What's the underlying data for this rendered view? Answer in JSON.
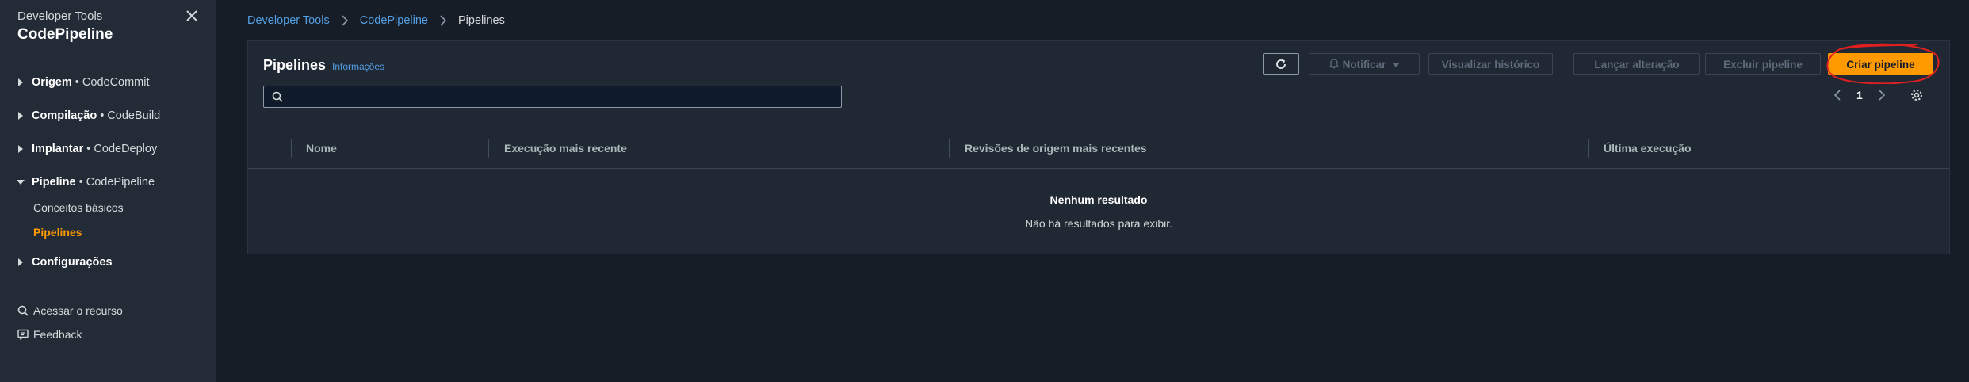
{
  "sidebar": {
    "service_name": "Developer Tools",
    "title": "CodePipeline",
    "sections": [
      {
        "name": "Origem",
        "service": "CodeCommit"
      },
      {
        "name": "Compilação",
        "service": "CodeBuild"
      },
      {
        "name": "Implantar",
        "service": "CodeDeploy"
      },
      {
        "name": "Pipeline",
        "service": "CodePipeline"
      },
      {
        "name": "Configurações"
      }
    ],
    "bullet": "•",
    "sub_items": [
      "Conceitos básicos",
      "Pipelines"
    ],
    "footer_links": [
      "Acessar o recurso",
      "Feedback"
    ]
  },
  "breadcrumb": [
    "Developer Tools",
    "CodePipeline",
    "Pipelines"
  ],
  "panel": {
    "title": "Pipelines",
    "info_link": "Informações",
    "buttons": {
      "notify": "Notificar",
      "history": "Visualizar histórico",
      "release": "Lançar alteração",
      "delete": "Excluir pipeline",
      "create": "Criar pipeline"
    },
    "search": {
      "value": "",
      "placeholder": ""
    },
    "pagination": {
      "current_page": "1"
    },
    "columns": [
      "Nome",
      "Execução mais recente",
      "Revisões de origem mais recentes",
      "Última execução"
    ],
    "empty_title": "Nenhum resultado",
    "empty_text": "Não há resultados para exibir."
  },
  "colors": {
    "background": "#161d26",
    "sidebar": "#232b37",
    "link": "#539fe5",
    "primary_button": "#ff9900",
    "active_nav": "#ff9900",
    "annotation": "#e02020"
  },
  "icons": [
    "close-icon",
    "caret-right-icon",
    "caret-down-icon",
    "search-icon",
    "feedback-icon",
    "refresh-icon",
    "bell-icon",
    "chevron-left-icon",
    "chevron-right-icon",
    "settings-icon"
  ]
}
